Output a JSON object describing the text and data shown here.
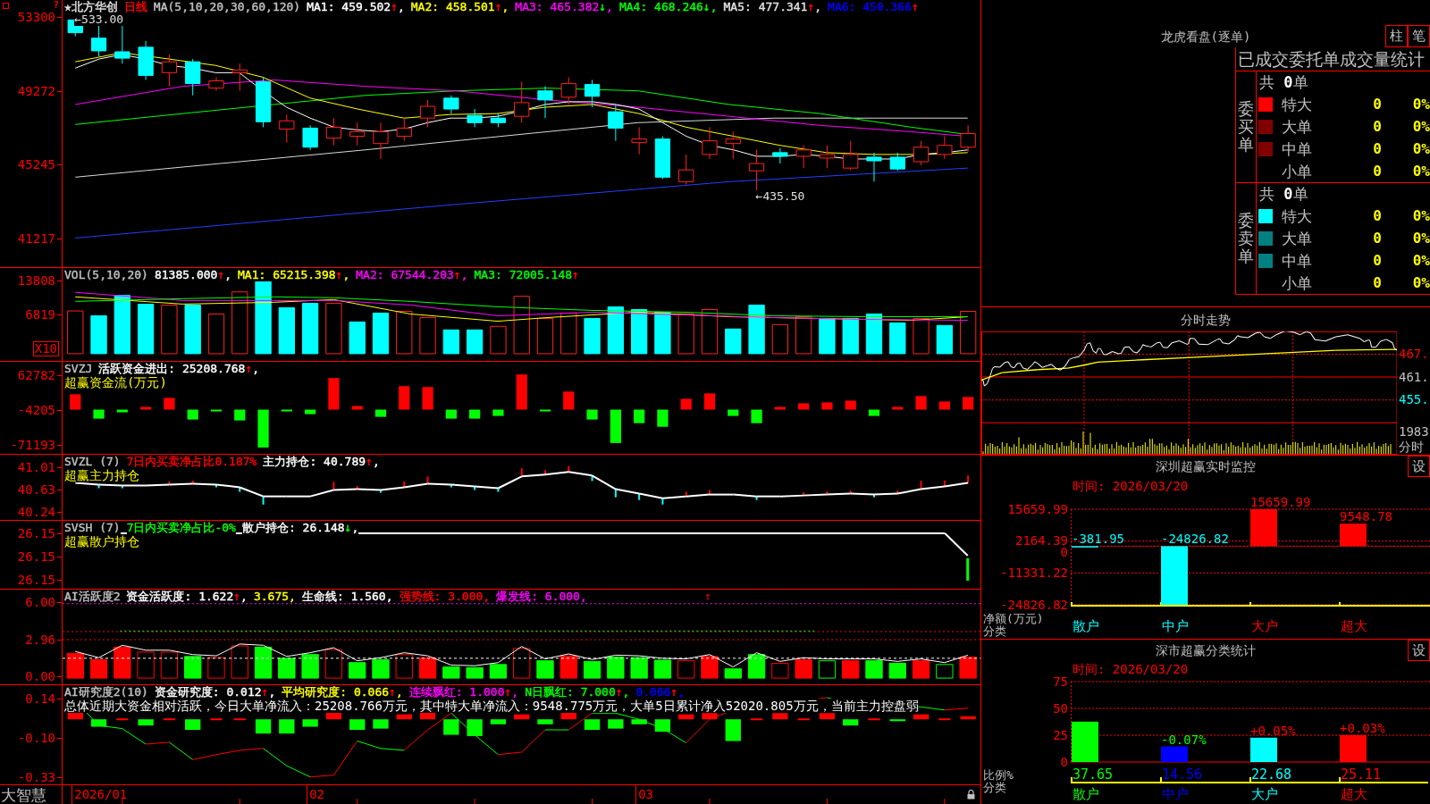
{
  "panels": [
    {
      "kind": "price",
      "axis": [
        "53300",
        "49272",
        "45245",
        "41217"
      ],
      "axis_marker": "?",
      "legend": [
        {
          "text": "★北方华创",
          "color": "#e0e0e0"
        },
        {
          "text": "日线",
          "color": "#ff0000"
        },
        {
          "text": "MA(5,10,20,30,60,120)",
          "color": "#c0c0c0"
        },
        {
          "text": "MA1: 459.502",
          "color": "#ffffff",
          "arrow": "↑",
          "rising": true,
          "tail": ","
        },
        {
          "text": "MA2: 458.501",
          "color": "#ffff00",
          "arrow": "↑",
          "rising": true,
          "tail": ","
        },
        {
          "text": "MA3: 465.382",
          "color": "#ff00ff",
          "arrow": "↓",
          "rising": false,
          "tail": ","
        },
        {
          "text": "MA4: 468.246",
          "color": "#00ff00",
          "arrow": "↓",
          "rising": false,
          "tail": ","
        },
        {
          "text": "MA5: 477.341",
          "color": "#e0e0e0",
          "arrow": "↑",
          "rising": true,
          "tail": ","
        },
        {
          "text": "MA6: 450.366",
          "color": "#0000ff",
          "arrow": "↑",
          "rising": true
        }
      ],
      "annotations": [
        "←533.00",
        "←435.50"
      ]
    },
    {
      "kind": "volume",
      "axis": [
        "13808",
        "6819"
      ],
      "scale_button": "X10",
      "legend": [
        {
          "text": "VOL(5,10,20)",
          "color": "#c0c0c0"
        },
        {
          "text": "81385.000",
          "color": "#ffffff",
          "arrow": "↑",
          "rising": true,
          "tail": ","
        },
        {
          "text": "MA1: 65215.398",
          "color": "#ffff00",
          "arrow": "↑",
          "rising": true,
          "tail": ","
        },
        {
          "text": "MA2: 67544.203",
          "color": "#ff00ff",
          "arrow": "↑",
          "rising": true,
          "tail": ","
        },
        {
          "text": "MA3: 72005.148",
          "color": "#00ff00",
          "arrow": "↑",
          "rising": true
        }
      ]
    },
    {
      "kind": "fund_flow",
      "axis": [
        "62782",
        "-4205",
        "-71193"
      ],
      "legend": [
        {
          "text": "SVZJ",
          "color": "#c0c0c0"
        },
        {
          "text": "活跃资金进出: 25208.768",
          "color": "#ffffff",
          "arrow": "↑",
          "rising": true,
          "tail": ","
        }
      ],
      "subtitle": "超赢资金流(万元)"
    },
    {
      "kind": "main_holding",
      "axis": [
        "41.01",
        "40.63",
        "40.24"
      ],
      "legend": [
        {
          "text": "SVZL (7)",
          "color": "#c0c0c0"
        },
        {
          "text": "7日内买卖净占比0.187%",
          "color": "#ff0000"
        },
        {
          "text": "主力持仓: 40.789",
          "color": "#ffffff",
          "arrow": "↑",
          "rising": true,
          "tail": ","
        }
      ],
      "subtitle": "超赢主力持仓"
    },
    {
      "kind": "retail_holding",
      "axis": [
        "26.15",
        "26.15",
        "26.15"
      ],
      "legend": [
        {
          "text": "SVSH (7)",
          "color": "#c0c0c0"
        },
        {
          "text": "7日内买卖净占比-0%",
          "color": "#00ff00"
        },
        {
          "text": "散户持仓: 26.148",
          "color": "#ffffff",
          "arrow": "↓",
          "rising": false,
          "tail": ","
        }
      ],
      "subtitle": "超赢散户持仓"
    },
    {
      "kind": "activity",
      "axis": [
        "6.00",
        "2.96",
        "0.00"
      ],
      "legend": [
        {
          "text": "AI活跃度2",
          "color": "#c0c0c0"
        },
        {
          "text": "资金活跃度: 1.622",
          "color": "#ffffff",
          "arrow": "↑",
          "rising": true,
          "tail": ","
        },
        {
          "text": "3.675,",
          "color": "#ffff00"
        },
        {
          "text": "生命线: 1.560,",
          "color": "#ffffff"
        },
        {
          "text": "强势线: 3.000,",
          "color": "#ff0000"
        },
        {
          "text": "爆发线: 6.000,",
          "color": "#ff00ff"
        }
      ],
      "signal_arrow": "↑"
    },
    {
      "kind": "research",
      "axis": [
        "0.14",
        "-0.10",
        "-0.33"
      ],
      "legend": [
        {
          "text": "AI研究度2(10)",
          "color": "#c0c0c0"
        },
        {
          "text": "资金研究度: 0.012",
          "color": "#ffffff",
          "arrow": "↑",
          "rising": true,
          "tail": ","
        },
        {
          "text": "平均研究度: 0.066",
          "color": "#ffff00",
          "arrow": "↑",
          "rising": true,
          "tail": ","
        },
        {
          "text": "连续飘红: 1.000",
          "color": "#ff00ff",
          "arrow": "↑",
          "rising": true,
          "tail": ","
        },
        {
          "text": "N日飘红: 7.000",
          "color": "#00ff00",
          "arrow": "↑",
          "rising": true,
          "tail": ","
        },
        {
          "text": "0.066",
          "color": "#0000ff",
          "arrow": "↑",
          "rising": true,
          "tail": ","
        }
      ],
      "subtitle": "总体近期大资金相对活跃，今日大单净流入：25208.766万元，其中特大单净流入：9548.775万元，大单5日累计净入52020.805万元，当前主力控盘弱"
    }
  ],
  "time_axis": {
    "brand": "大智慧",
    "dates": [
      "2026/01",
      "02",
      "03"
    ]
  },
  "dragon": {
    "title": "龙虎看盘(逐单)",
    "buttons": [
      "柱",
      "笔"
    ],
    "table_title": "已成交委托单成交量统计",
    "groups": [
      {
        "label": "委买单",
        "total": "共 **0**单",
        "rows": [
          {
            "name": "特大",
            "color": "#ff0000",
            "count": "0",
            "share": "0%"
          },
          {
            "name": "大单",
            "color": "#800000",
            "count": "0",
            "share": "0%"
          },
          {
            "name": "中单",
            "color": "#800000",
            "count": "0",
            "share": "0%"
          },
          {
            "name": "小单",
            "count": "0",
            "share": "0%"
          }
        ]
      },
      {
        "label": "委卖单",
        "total": "共 **0**单",
        "rows": [
          {
            "name": "特大",
            "color": "#00ffff",
            "count": "0",
            "share": "0%"
          },
          {
            "name": "大单",
            "color": "#008080",
            "count": "0",
            "share": "0%"
          },
          {
            "name": "中单",
            "color": "#008080",
            "count": "0",
            "share": "0%"
          },
          {
            "name": "小单",
            "count": "0",
            "share": "0%"
          }
        ]
      }
    ]
  },
  "intraday": {
    "title": "分时走势",
    "price_labels": [
      {
        "text": "467.",
        "color": "#ff0000"
      },
      {
        "text": "461.",
        "color": "#c0c0c0"
      },
      {
        "text": "455.",
        "color": "#00ffff"
      }
    ],
    "volume_labels": [
      "1983",
      "分时"
    ]
  },
  "monitor": {
    "title": "深圳超赢实时监控",
    "settings": "设",
    "time": "时间: 2026/03/20",
    "chart_data": {
      "type": "bar",
      "xlabel": "分类",
      "ylabel": "净额(万元)",
      "categories": [
        "散户",
        "中户",
        "大户",
        "超大"
      ],
      "values": [
        -381.95,
        -24826.82,
        15659.99,
        9548.78
      ],
      "ylim": [
        -24826.82,
        15659.99
      ],
      "yticks": [
        15659.99,
        2164.39,
        0,
        -11331.22,
        -24826.82
      ],
      "grid": true,
      "data_labels": true
    }
  },
  "classification": {
    "title": "深市超赢分类统计",
    "settings": "设",
    "time": "时间: 2026/03/20",
    "chart_data": {
      "type": "bar",
      "xlabel": "分类",
      "ylabel": "比例%",
      "categories": [
        "散户",
        "中户",
        "大户",
        "超大"
      ],
      "values": [
        37.65,
        14.56,
        22.68,
        25.11
      ],
      "colors": [
        "#00ff00",
        "#0000ff",
        "#00ffff",
        "#ff0000"
      ],
      "ylim": [
        0,
        75
      ],
      "yticks": [
        75,
        50,
        25,
        0
      ],
      "grid": true,
      "data_labels": true
    },
    "changes": [
      {
        "text": "-0.07%",
        "color": "#00ff00"
      },
      {
        "text": "+0.05%",
        "color": "#ff0000"
      },
      {
        "text": "+0.03%",
        "color": "#ff0000"
      }
    ]
  }
}
